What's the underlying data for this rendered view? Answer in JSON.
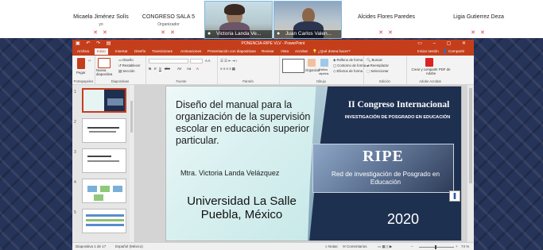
{
  "participants": [
    {
      "name": "Micaela Jiménez Solís",
      "role": "yo"
    },
    {
      "name": "CONGRESO SALA 5",
      "role": "Organizador"
    },
    {
      "name": "Alcides Flores Paredes",
      "role": ""
    },
    {
      "name": "Ligia Gutierrez Deza",
      "role": ""
    }
  ],
  "videos": [
    {
      "name": "Victoria Landa Ve..."
    },
    {
      "name": "Juan Carlos Valen..."
    }
  ],
  "ppt": {
    "window_title": "PONENCIA-RIPE VLV - PowerPoint",
    "tabs": [
      "Archivo",
      "Inicio",
      "Insertar",
      "Diseño",
      "Transiciones",
      "Animaciones",
      "Presentación con diapositivas",
      "Revisar",
      "Vista",
      "Acrobat"
    ],
    "active_tab": "Inicio",
    "tell_me": "¿Qué desea hacer?",
    "sign_in": "Iniciar sesión",
    "share": "Compartir",
    "ribbon": {
      "paste": "Pegar",
      "clipboard": "Portapapeles",
      "new_slide": "Nueva diapositiva",
      "layout": "Diseño",
      "reset": "Restablecer",
      "section": "Sección",
      "slides": "Diapositivas",
      "font": "Fuente",
      "paragraph": "Párrafo",
      "arrange": "Organizar",
      "quick_styles": "Estilos rápidos",
      "shape_fill": "Relleno de forma",
      "shape_outline": "Contorno de forma",
      "shape_effects": "Efectos de forma",
      "drawing": "Dibujo",
      "find": "Buscar",
      "replace": "Reemplazar",
      "select": "Seleccionar",
      "editing": "Edición",
      "create_pdf": "Crear y compartir PDF de Adobe",
      "adobe": "Adobe Acrobat"
    },
    "status": {
      "slide_info": "Diapositiva 1 de 17",
      "language": "Español (México)",
      "notes": "Notas",
      "comments": "Comentarios",
      "zoom": "74 %"
    }
  },
  "slide": {
    "title": "Diseño del manual para la organización de la supervisión escolar en educación superior particular.",
    "author": "Mtra. Victoria Landa Velázquez",
    "university": "Universidad La Salle Puebla, México",
    "congress": "II Congreso Internacional",
    "subtitle": "INVESTIGACIÓN DE POSGRADO EN EDUCACIÓN",
    "logo": "RIPE",
    "logo_sub": "Red de investigación de Posgrado en Educación",
    "year": "2020"
  },
  "thumbnails": [
    "1",
    "2",
    "3",
    "4",
    "5"
  ]
}
